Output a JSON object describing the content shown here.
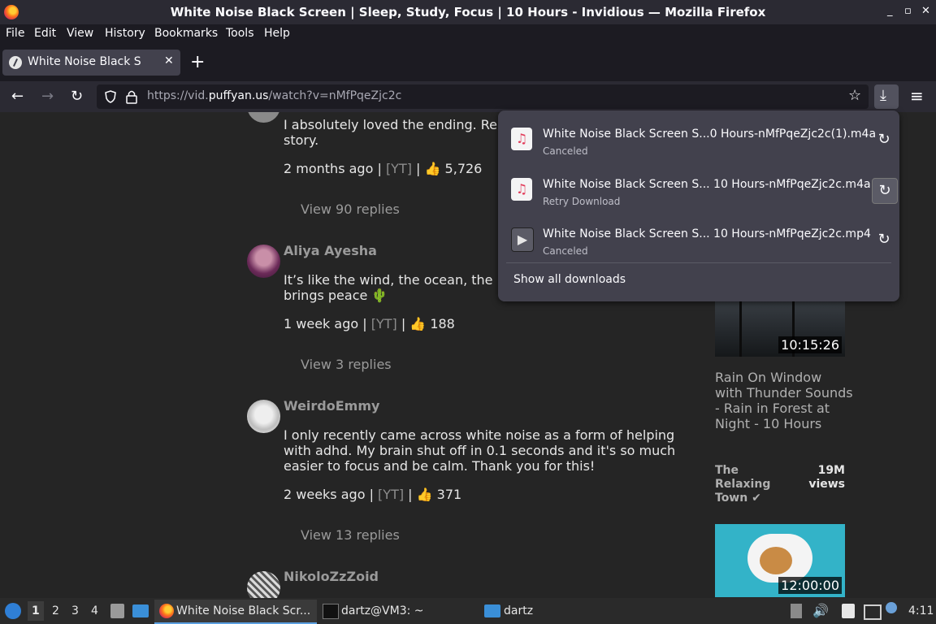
{
  "window": {
    "title": "White Noise Black Screen | Sleep, Study, Focus | 10 Hours - Invidious — Mozilla Firefox",
    "controls": [
      "_",
      "▫",
      "✕"
    ]
  },
  "menu": [
    "File",
    "Edit",
    "View",
    "History",
    "Bookmarks",
    "Tools",
    "Help"
  ],
  "tab": {
    "label": "White Noise Black Screen",
    "close": "✕",
    "new": "+"
  },
  "nav": {
    "back": "←",
    "forward": "→",
    "reload": "↻",
    "url_prefix": "https://vid.",
    "url_domain": "puffyan.us",
    "url_path": "/watch?v=nMfPqeZjc2c",
    "bookmark": "☆",
    "downloads": "⤓",
    "menu": "≡"
  },
  "comments": [
    {
      "text": "I absolutely loved the ending. Re\nstory.",
      "date": "2 months ago",
      "source": "[YT]",
      "likes": "5,726",
      "replies": "View 90 replies"
    },
    {
      "author": "Aliya Ayesha",
      "text": "It’s like the wind, the ocean, the\nbrings peace 🌵",
      "date": "1 week ago",
      "source": "[YT]",
      "likes": "188",
      "replies": "View 3 replies"
    },
    {
      "author": "WeirdoEmmy",
      "text": "I only recently came across white noise as a form of helping with adhd. My brain shut off in 0.1 seconds and it's so much easier to focus and be calm. Thank you for this!",
      "date": "2 weeks ago",
      "source": "[YT]",
      "likes": "371",
      "replies": "View 13 replies"
    },
    {
      "author": "NikoloZzZoid"
    }
  ],
  "sidebar": {
    "video1": {
      "duration": "10:15:26",
      "title": "Rain On Window with Thunder Sounds - Rain in Forest at Night - 10 Hours",
      "channel": "The Relaxing Town ✔",
      "views": "19M views"
    },
    "video2": {
      "duration": "12:00:00"
    }
  },
  "downloads": {
    "items": [
      {
        "name": "White Noise Black Screen S...0 Hours-nMfPqeZjc2c(1).m4a",
        "status": "Canceled",
        "icon": "music-note-icon"
      },
      {
        "name": "White Noise Black Screen S... 10 Hours-nMfPqeZjc2c.m4a",
        "status": "Retry Download",
        "icon": "music-note-icon"
      },
      {
        "name": "White Noise Black Screen S... 10 Hours-nMfPqeZjc2c.mp4",
        "status": "Canceled",
        "icon": "video-icon"
      }
    ],
    "show_all": "Show all downloads"
  },
  "taskbar": {
    "workspaces": [
      "1",
      "2",
      "3",
      "4"
    ],
    "firefox_task": "White Noise Black Scr...",
    "terminal_task": "dartz@VM3: ~",
    "files_task": "dartz",
    "clock": "4:11"
  }
}
